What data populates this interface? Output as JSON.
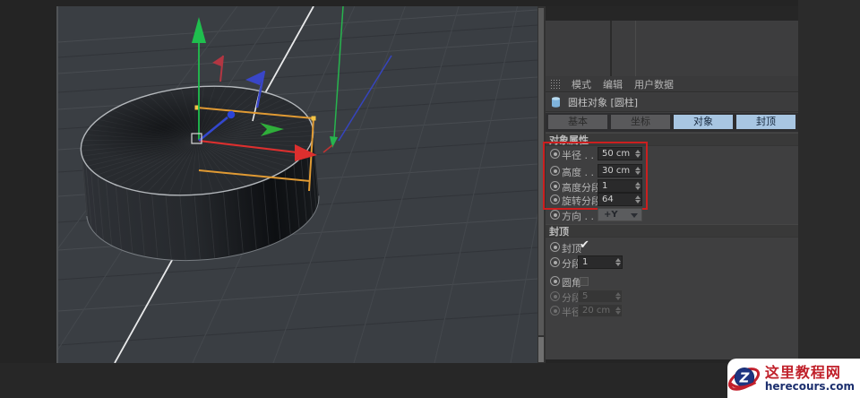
{
  "viewport": {
    "axis_colors": {
      "x": "#dd2f2e",
      "y": "#1fbf4e",
      "z": "#3347cf"
    },
    "selection_color": "#e09a33",
    "highlight_line_color": "#e9eaeb"
  },
  "top_menu": {
    "grid_icon": "menu-grid-icon",
    "items": [
      "模式",
      "编辑",
      "用户数据"
    ]
  },
  "object_row": {
    "icon": "cylinder-icon",
    "title": "圆柱对象 [圆柱]"
  },
  "tabs": [
    {
      "label": "基本",
      "selected": false
    },
    {
      "label": "坐标",
      "selected": false
    },
    {
      "label": "对象",
      "selected": true
    },
    {
      "label": "封顶",
      "selected": true
    }
  ],
  "object_props": {
    "header": "对象属性",
    "highlight_box_color": "#cc1f1f",
    "rows": [
      {
        "label": "半径 . . .",
        "value": "50 cm"
      },
      {
        "label": "高度 . . .",
        "value": "30 cm"
      },
      {
        "label": "高度分段",
        "value": "1"
      },
      {
        "label": "旋转分段",
        "value": "64"
      }
    ],
    "direction": {
      "label": "方向 . . .",
      "value": "+Y"
    }
  },
  "caps": {
    "header": "封顶",
    "cap": {
      "label": "封顶",
      "checked": true,
      "check_glyph": "✔"
    },
    "segments": {
      "label": "分段",
      "value": "1"
    },
    "fillet": {
      "label": "圆角",
      "checked": false
    },
    "fillet_segments": {
      "label": "分段",
      "value": "5",
      "disabled": true
    },
    "fillet_radius": {
      "label": "半径",
      "value": "20 cm",
      "disabled": true
    }
  },
  "watermark": {
    "logo_letter": "Z",
    "site_name": "这里教程网",
    "site_url": "herecours.com",
    "brand_red": "#c0202a",
    "brand_navy": "#1c2f6e"
  }
}
